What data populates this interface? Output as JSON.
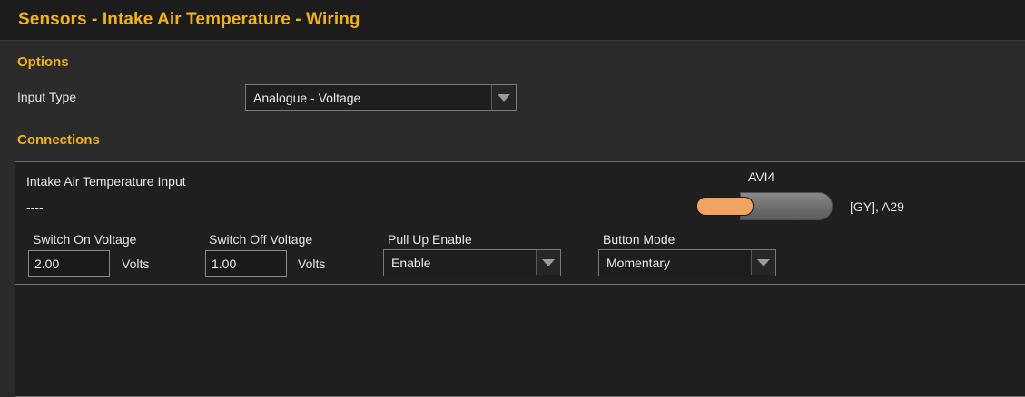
{
  "header": {
    "title": "Sensors - Intake Air Temperature - Wiring"
  },
  "options": {
    "section_label": "Options",
    "input_type_label": "Input Type",
    "input_type_value": "Analogue - Voltage"
  },
  "connections": {
    "section_label": "Connections",
    "input_name": "Intake Air Temperature Input",
    "input_sub": "----",
    "pin_label": "AVI4",
    "wire_info": "[GY], A29",
    "switch_on": {
      "label": "Switch On Voltage",
      "value": "2.00",
      "unit": "Volts"
    },
    "switch_off": {
      "label": "Switch Off Voltage",
      "value": "1.00",
      "unit": "Volts"
    },
    "pull_up": {
      "label": "Pull Up Enable",
      "value": "Enable"
    },
    "button_mode": {
      "label": "Button Mode",
      "value": "Momentary"
    }
  },
  "colors": {
    "accent": "#f2b21b",
    "wire_core": "#f1a362",
    "wire_insulation": "#7a7a7a"
  }
}
